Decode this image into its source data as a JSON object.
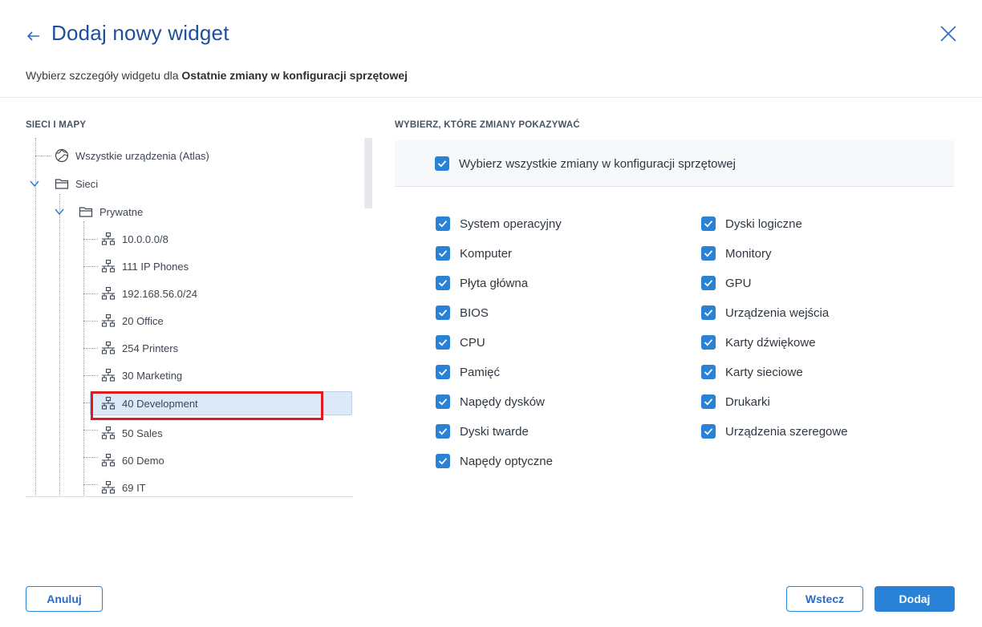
{
  "header": {
    "title": "Dodaj nowy widget",
    "subtitle_prefix": "Wybierz szczegóły widgetu dla ",
    "subtitle_bold": "Ostatnie zmiany w konfiguracji sprzętowej"
  },
  "left_panel": {
    "label": "SIECI I MAPY",
    "tree": [
      {
        "label": "Wszystkie urządzenia (Atlas)",
        "icon": "globe-icon"
      },
      {
        "label": "Sieci",
        "icon": "folder-icon",
        "expanded": true
      },
      {
        "label": "Prywatne",
        "icon": "folder-icon",
        "expanded": true
      },
      {
        "label": "10.0.0.0/8",
        "icon": "network-icon"
      },
      {
        "label": "111 IP Phones",
        "icon": "network-icon"
      },
      {
        "label": "192.168.56.0/24",
        "icon": "network-icon"
      },
      {
        "label": "20 Office",
        "icon": "network-icon"
      },
      {
        "label": "254 Printers",
        "icon": "network-icon"
      },
      {
        "label": "30 Marketing",
        "icon": "network-icon"
      },
      {
        "label": "40 Development",
        "icon": "network-icon",
        "selected": true
      },
      {
        "label": "50 Sales",
        "icon": "network-icon"
      },
      {
        "label": "60 Demo",
        "icon": "network-icon"
      },
      {
        "label": "69 IT",
        "icon": "network-icon"
      }
    ]
  },
  "right_panel": {
    "label": "WYBIERZ, KTÓRE ZMIANY POKAZYWAĆ",
    "select_all": {
      "label": "Wybierz wszystkie zmiany w konfiguracji sprzętowej",
      "checked": true
    },
    "column_left": [
      {
        "label": "System operacyjny",
        "checked": true
      },
      {
        "label": "Komputer",
        "checked": true
      },
      {
        "label": "Płyta główna",
        "checked": true
      },
      {
        "label": "BIOS",
        "checked": true
      },
      {
        "label": "CPU",
        "checked": true
      },
      {
        "label": "Pamięć",
        "checked": true
      },
      {
        "label": "Napędy dysków",
        "checked": true
      },
      {
        "label": "Dyski twarde",
        "checked": true
      },
      {
        "label": "Napędy optyczne",
        "checked": true
      }
    ],
    "column_right": [
      {
        "label": "Dyski logiczne",
        "checked": true
      },
      {
        "label": "Monitory",
        "checked": true
      },
      {
        "label": "GPU",
        "checked": true
      },
      {
        "label": "Urządzenia wejścia",
        "checked": true
      },
      {
        "label": "Karty dźwiękowe",
        "checked": true
      },
      {
        "label": "Karty sieciowe",
        "checked": true
      },
      {
        "label": "Drukarki",
        "checked": true
      },
      {
        "label": "Urządzenia szeregowe",
        "checked": true
      }
    ]
  },
  "footer": {
    "cancel_label": "Anuluj",
    "back_label": "Wstecz",
    "add_label": "Dodaj"
  },
  "colors": {
    "accent": "#2a82d7",
    "title": "#1e4f9a",
    "selection": "#dce9f8",
    "highlight": "#e01b1b"
  }
}
